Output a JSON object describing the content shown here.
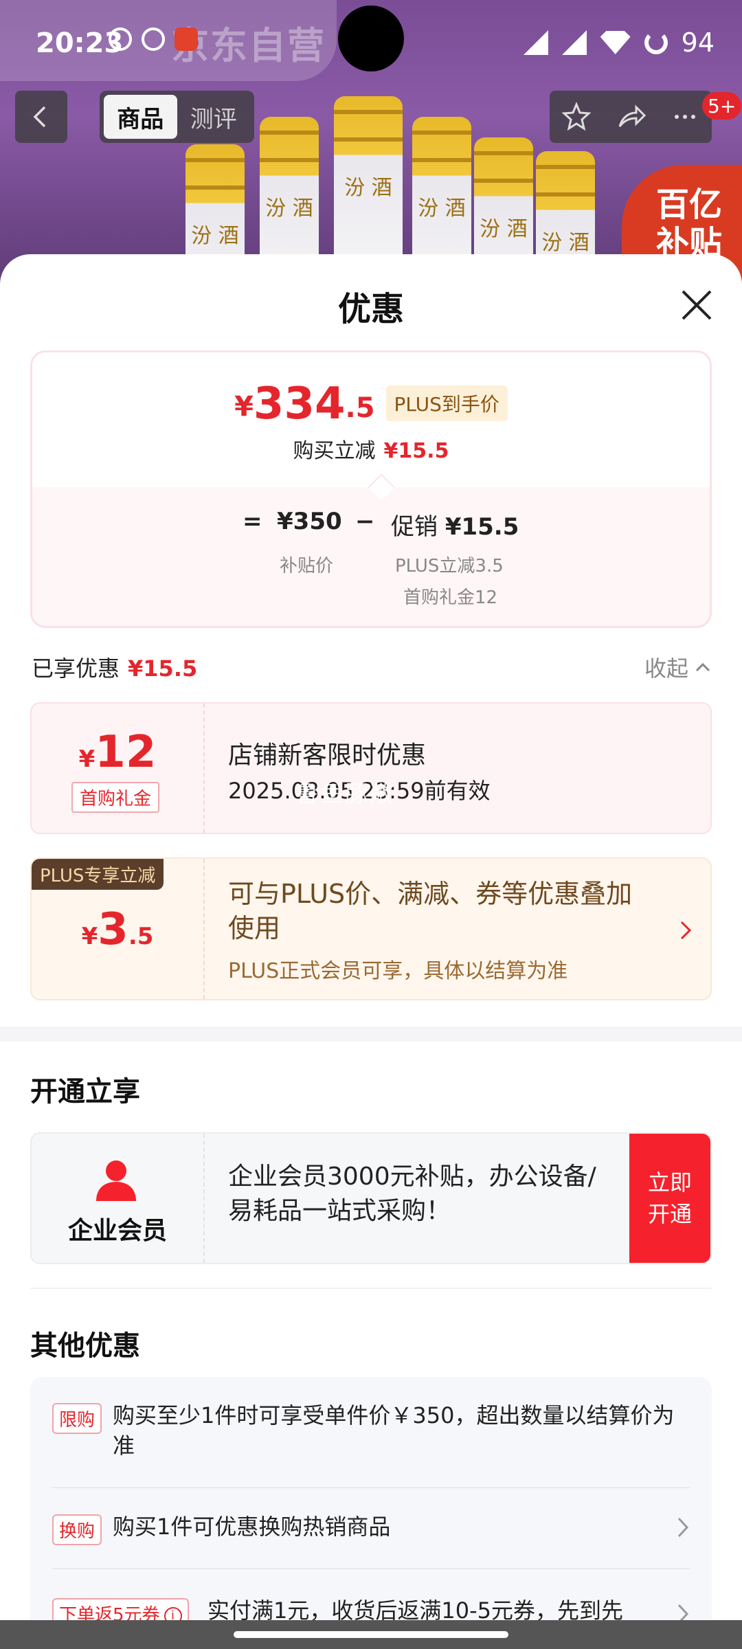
{
  "status_bar": {
    "time": "20:23",
    "battery": "94"
  },
  "header": {
    "banner_text": "京东自营",
    "tabs": [
      "商品",
      "测评"
    ],
    "active_tab": "商品",
    "badge": "5+",
    "subsidy_text": [
      "百亿",
      "补贴"
    ],
    "bottle_label": "汾 酒"
  },
  "sheet": {
    "title": "优惠",
    "price": {
      "currency": "¥",
      "integer": "334",
      "decimal": ".5",
      "tag": "PLUS到手价",
      "reduce_label": "购买立减",
      "reduce_value": "¥15.5",
      "calc_equal": "=",
      "base_price": "¥350",
      "minus": "−",
      "promo_label": "促销",
      "promo_value": "¥15.5",
      "base_label": "补贴价",
      "promo_item_1": "PLUS立减3.5",
      "promo_item_2": "首购礼金12"
    },
    "enjoyed": {
      "label": "已享优惠",
      "value": "¥15.5",
      "toggle": "收起"
    },
    "coupon_1": {
      "currency": "¥",
      "amount": "12",
      "tag": "首购礼金",
      "title": "店铺新客限时优惠",
      "validity": "2025.08.05 23:59前有效",
      "watermark": "鲁鱼豚敞"
    },
    "coupon_2": {
      "ribbon": "PLUS专享立减",
      "currency": "¥",
      "amount": "3",
      "decimal": ".5",
      "title": "可与PLUS价、满减、券等优惠叠加使用",
      "desc": "PLUS正式会员可享，具体以结算为准"
    },
    "open_section": {
      "title": "开通立享",
      "member_name": "企业会员",
      "member_desc": "企业会员3000元补贴，办公设备/易耗品一站式采购！",
      "button": "立即开通"
    },
    "other_section": {
      "title": "其他优惠",
      "items": [
        {
          "tag": "限购",
          "text": "购买至少1件时可享受单件价￥350，超出数量以结算价为准"
        },
        {
          "tag": "换购",
          "text": "购买1件可优惠换购热销商品"
        },
        {
          "tag": "下单返5元券",
          "text": "实付满1元，收货后返满10-5元券，先到先"
        }
      ]
    }
  },
  "colors": {
    "accent_red": "#e4262c",
    "button_red": "#f5222d",
    "plus_brown": "#5b3f2b"
  }
}
